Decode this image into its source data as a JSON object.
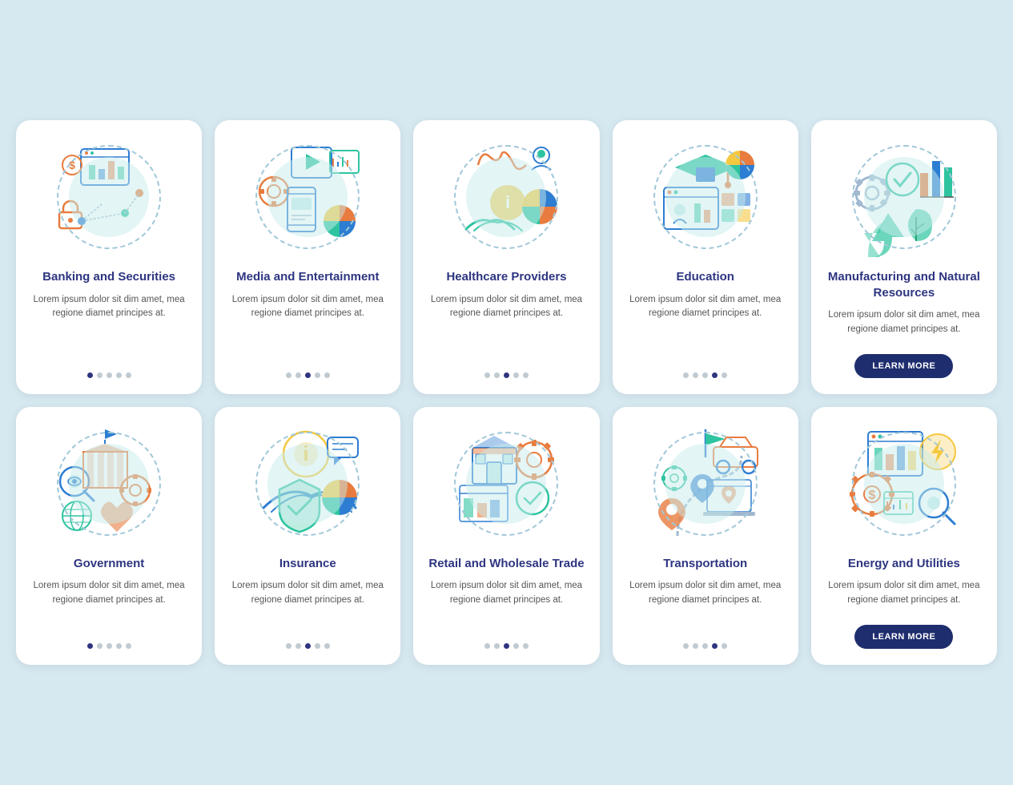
{
  "cards": [
    {
      "id": "banking",
      "title": "Banking and Securities",
      "body": "Lorem ipsum dolor sit dim amet, mea regione diamet principes at.",
      "dots": [
        true,
        false,
        false,
        false,
        false
      ],
      "hasButton": false,
      "activeDotsCount": 1
    },
    {
      "id": "media",
      "title": "Media and Entertainment",
      "body": "Lorem ipsum dolor sit dim amet, mea regione diamet principes at.",
      "dots": [
        false,
        false,
        true,
        false,
        false
      ],
      "hasButton": false,
      "activeDotsCount": 1
    },
    {
      "id": "healthcare",
      "title": "Healthcare Providers",
      "body": "Lorem ipsum dolor sit dim amet, mea regione diamet principes at.",
      "dots": [
        false,
        false,
        true,
        false,
        false
      ],
      "hasButton": false,
      "activeDotsCount": 1
    },
    {
      "id": "education",
      "title": "Education",
      "body": "Lorem ipsum dolor sit dim amet, mea regione diamet principes at.",
      "dots": [
        false,
        false,
        false,
        true,
        false
      ],
      "hasButton": false,
      "activeDotsCount": 1
    },
    {
      "id": "manufacturing",
      "title": "Manufacturing and Natural Resources",
      "body": "Lorem ipsum dolor sit dim amet, mea regione diamet principes at.",
      "dots": [],
      "hasButton": true,
      "activeDotsCount": 0,
      "buttonLabel": "LEARN MORE"
    },
    {
      "id": "government",
      "title": "Government",
      "body": "Lorem ipsum dolor sit dim amet, mea regione diamet principes at.",
      "dots": [
        true,
        false,
        false,
        false,
        false
      ],
      "hasButton": false,
      "activeDotsCount": 1
    },
    {
      "id": "insurance",
      "title": "Insurance",
      "body": "Lorem ipsum dolor sit dim amet, mea regione diamet principes at.",
      "dots": [
        false,
        false,
        true,
        false,
        false
      ],
      "hasButton": false,
      "activeDotsCount": 1
    },
    {
      "id": "retail",
      "title": "Retail and Wholesale Trade",
      "body": "Lorem ipsum dolor sit dim amet, mea regione diamet principes at.",
      "dots": [
        false,
        false,
        true,
        false,
        false
      ],
      "hasButton": false,
      "activeDotsCount": 1
    },
    {
      "id": "transportation",
      "title": "Transportation",
      "body": "Lorem ipsum dolor sit dim amet, mea regione diamet principes at.",
      "dots": [
        false,
        false,
        false,
        true,
        false
      ],
      "hasButton": false,
      "activeDotsCount": 1
    },
    {
      "id": "energy",
      "title": "Energy and Utilities",
      "body": "Lorem ipsum dolor sit dim amet, mea regione diamet principes at.",
      "dots": [],
      "hasButton": true,
      "activeDotsCount": 0,
      "buttonLabel": "LEARN MORE"
    }
  ],
  "lorem": "Lorem ipsum dolor sit dim amet, mea regione diamet principes at."
}
